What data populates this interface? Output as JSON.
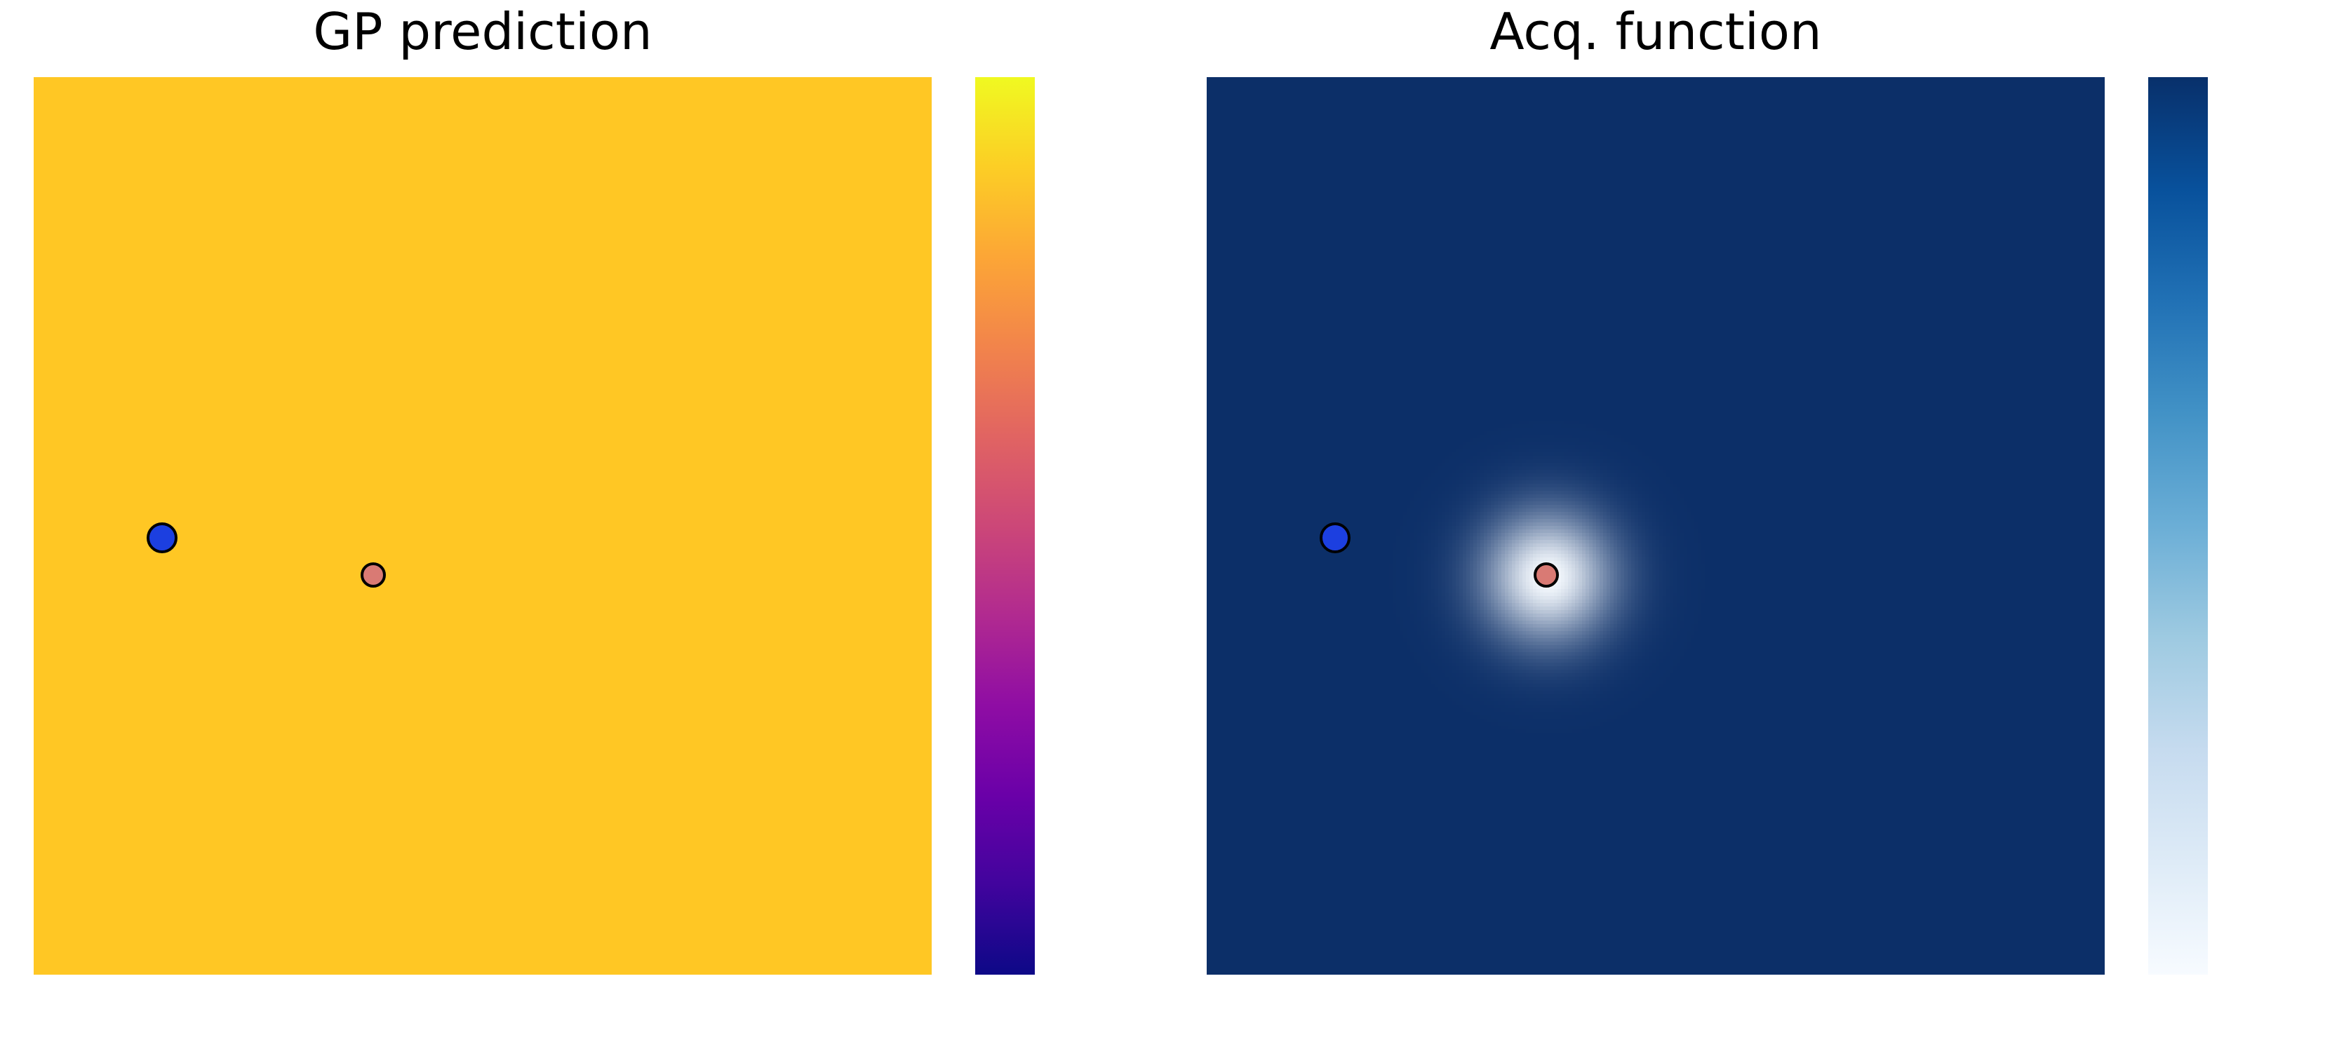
{
  "left": {
    "title": "GP prediction",
    "colormap": "plasma",
    "field_color_uniform": "#ffc724",
    "blue_point": {
      "x_frac": 0.143,
      "y_frac": 0.513
    },
    "red_point": {
      "x_frac": 0.378,
      "y_frac": 0.555
    }
  },
  "right": {
    "title": "Acq. function",
    "colormap": "blues_reversed",
    "field_color_far": "#0c2f68",
    "blue_point": {
      "x_frac": 0.143,
      "y_frac": 0.513
    },
    "red_point": {
      "x_frac": 0.378,
      "y_frac": 0.555
    },
    "hotspot": {
      "x_frac": 0.378,
      "y_frac": 0.555,
      "sigma_frac": 0.05
    }
  },
  "chart_data": [
    {
      "type": "heatmap",
      "title": "GP prediction",
      "xlabel": "",
      "ylabel": "",
      "xlim": [
        0,
        1
      ],
      "ylim": [
        0,
        1
      ],
      "colormap": "plasma",
      "description": "Near-uniform field at high (yellow) value with two sample points overlaid.",
      "points": [
        {
          "name": "context/blue",
          "x": 0.143,
          "y": 0.487,
          "color": "#1c3fe0"
        },
        {
          "name": "proposed/red",
          "x": 0.378,
          "y": 0.445,
          "color": "#d97a74"
        }
      ]
    },
    {
      "type": "heatmap",
      "title": "Acq. function",
      "xlabel": "",
      "ylabel": "",
      "xlim": [
        0,
        1
      ],
      "ylim": [
        0,
        1
      ],
      "colormap": "Blues_r",
      "description": "Acquisition is near-zero (dark navy) everywhere except a bright localized peak at the red point.",
      "peak": {
        "x": 0.378,
        "y": 0.445,
        "sigma": 0.05
      },
      "points": [
        {
          "name": "context/blue",
          "x": 0.143,
          "y": 0.487,
          "color": "#1c3fe0"
        },
        {
          "name": "proposed/red",
          "x": 0.378,
          "y": 0.445,
          "color": "#d97a74"
        }
      ]
    }
  ]
}
